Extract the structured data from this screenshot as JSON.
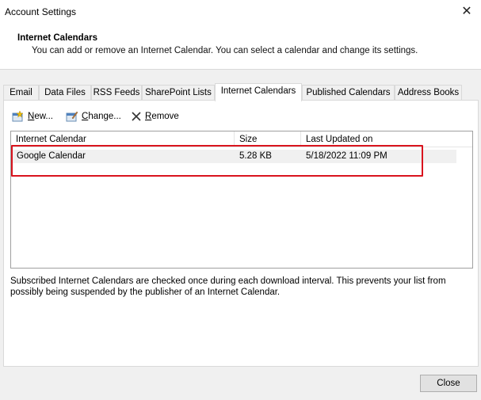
{
  "window": {
    "title": "Account Settings",
    "close_glyph": "✕"
  },
  "header": {
    "section_title": "Internet Calendars",
    "description": "You can add or remove an Internet Calendar. You can select a calendar and change its settings."
  },
  "tabs": [
    {
      "label": "Email",
      "active": false
    },
    {
      "label": "Data Files",
      "active": false
    },
    {
      "label": "RSS Feeds",
      "active": false
    },
    {
      "label": "SharePoint Lists",
      "active": false
    },
    {
      "label": "Internet Calendars",
      "active": true
    },
    {
      "label": "Published Calendars",
      "active": false
    },
    {
      "label": "Address Books",
      "active": false
    }
  ],
  "toolbar": {
    "new_label_u": "N",
    "new_label_rest": "ew...",
    "change_label_u": "C",
    "change_label_rest": "hange...",
    "remove_label_pre": "",
    "remove_label_u": "R",
    "remove_label_rest": "emove"
  },
  "list": {
    "columns": [
      "Internet Calendar",
      "Size",
      "Last Updated on"
    ],
    "rows": [
      {
        "name": "Google Calendar",
        "size": "5.28 KB",
        "updated": "5/18/2022 11:09 PM"
      }
    ]
  },
  "info": {
    "text": "Subscribed Internet Calendars are checked once during each download interval. This prevents your list from possibly being suspended by the publisher of an Internet Calendar."
  },
  "footer": {
    "close_label": "Close"
  },
  "colors": {
    "highlight": "#d9141e",
    "window_bg": "#f0f0f0"
  }
}
